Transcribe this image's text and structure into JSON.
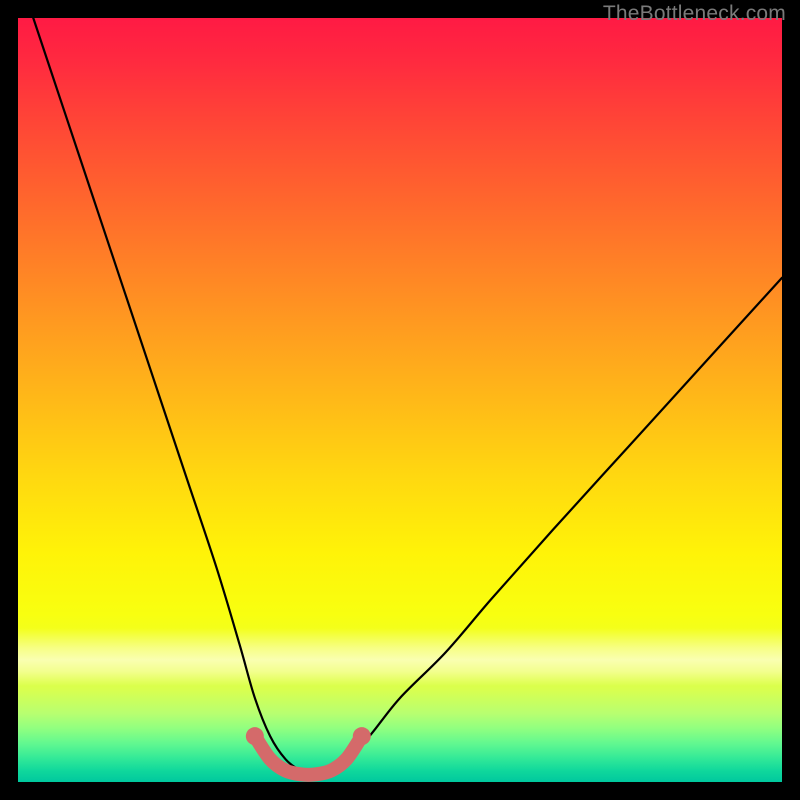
{
  "watermark": "TheBottleneck.com",
  "chart_data": {
    "type": "line",
    "title": "",
    "xlabel": "",
    "ylabel": "",
    "xlim": [
      0,
      100
    ],
    "ylim": [
      0,
      100
    ],
    "grid": false,
    "series": [
      {
        "name": "bottleneck-curve",
        "x": [
          2,
          6,
          10,
          14,
          18,
          22,
          26,
          29,
          31,
          33,
          35,
          37,
          39,
          41,
          43,
          46,
          50,
          56,
          62,
          70,
          80,
          90,
          100
        ],
        "y": [
          100,
          88,
          76,
          64,
          52,
          40,
          28,
          18,
          11,
          6,
          3,
          1.5,
          1,
          1.5,
          3,
          6,
          11,
          17,
          24,
          33,
          44,
          55,
          66
        ]
      }
    ],
    "marker_segment": {
      "name": "optimal-range",
      "color": "#d46a6a",
      "x": [
        31,
        33,
        35,
        37,
        39,
        41,
        43,
        45
      ],
      "y": [
        6,
        3,
        1.5,
        1,
        1,
        1.5,
        3,
        6
      ]
    }
  }
}
